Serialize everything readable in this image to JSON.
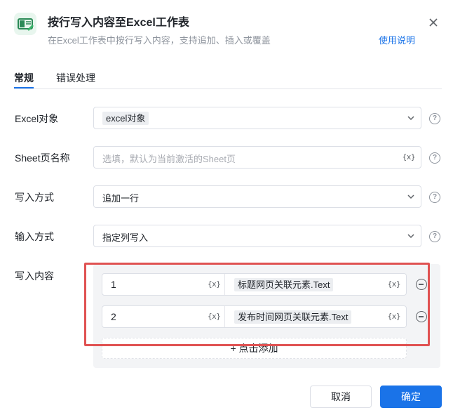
{
  "header": {
    "title": "按行写入内容至Excel工作表",
    "subtitle": "在Excel工作表中按行写入内容，支持追加、插入或覆盖",
    "help_link": "使用说明"
  },
  "tabs": [
    {
      "label": "常规",
      "active": true
    },
    {
      "label": "错误处理",
      "active": false
    }
  ],
  "form": {
    "excel_object": {
      "label": "Excel对象",
      "value": "excel对象"
    },
    "sheet_name": {
      "label": "Sheet页名称",
      "placeholder": "选填，默认为当前激活的Sheet页",
      "var_icon": "{x}"
    },
    "write_mode": {
      "label": "写入方式",
      "value": "追加一行"
    },
    "input_mode": {
      "label": "输入方式",
      "value": "指定列写入"
    },
    "content": {
      "label": "写入内容",
      "rows": [
        {
          "column": "1",
          "value": "标题网页关联元素.Text"
        },
        {
          "column": "2",
          "value": "发布时间网页关联元素.Text"
        }
      ],
      "add_label": "+ 点击添加"
    }
  },
  "var_icon": "{x}",
  "footer": {
    "cancel_label": "取消",
    "ok_label": "确定"
  },
  "colors": {
    "accent": "#1a73e8",
    "highlight": "#e05252"
  }
}
